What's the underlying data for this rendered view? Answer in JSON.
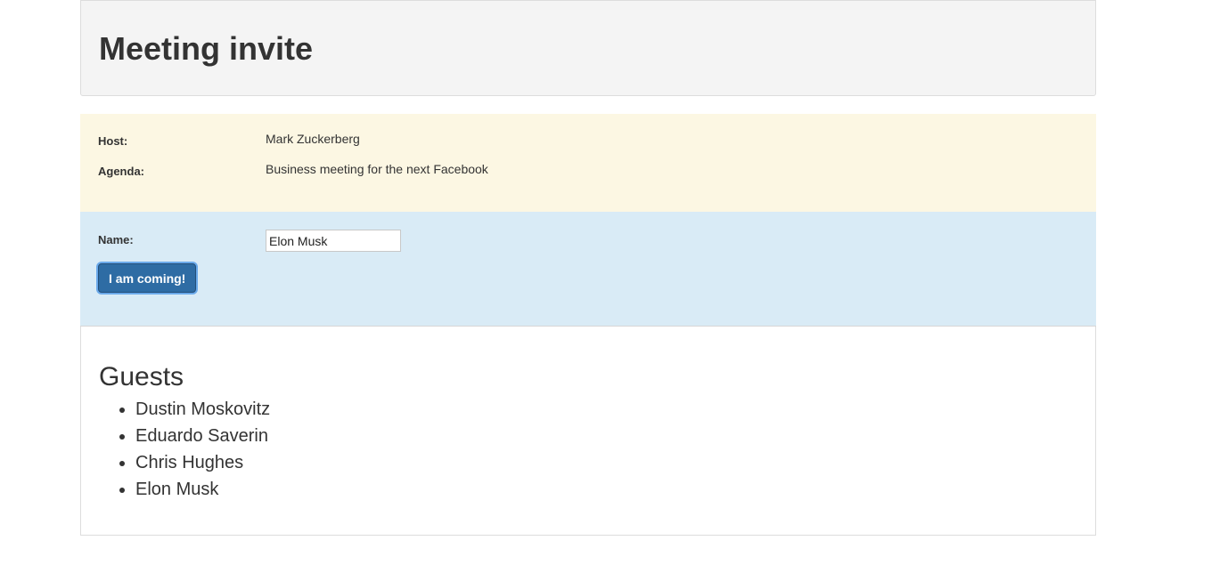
{
  "header": {
    "title": "Meeting invite"
  },
  "details": {
    "host_label": "Host:",
    "host_value": "Mark Zuckerberg",
    "agenda_label": "Agenda:",
    "agenda_value": "Business meeting for the next Facebook"
  },
  "rsvp": {
    "name_label": "Name:",
    "name_value": "Elon Musk",
    "submit_label": "I am coming!"
  },
  "guests": {
    "title": "Guests",
    "items": [
      "Dustin Moskovitz",
      "Eduardo Saverin",
      "Chris Hughes",
      "Elon Musk"
    ]
  },
  "colors": {
    "header_bg": "#f4f4f4",
    "details_bg": "#fcf7e3",
    "rsvp_bg": "#d9ebf6",
    "button_bg": "#2e6ca4"
  }
}
